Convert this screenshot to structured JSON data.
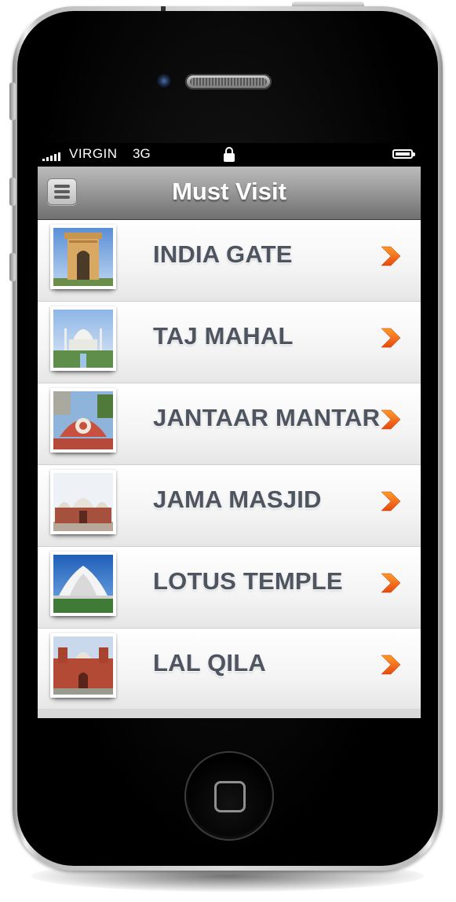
{
  "status_bar": {
    "carrier": "VIRGIN",
    "network": "3G"
  },
  "nav_bar": {
    "title": "Must Visit",
    "menu_icon": "hamburger-menu-icon"
  },
  "list": {
    "items": [
      {
        "label": "INDIA GATE",
        "thumbnail": "india-gate-thumbnail"
      },
      {
        "label": "TAJ MAHAL",
        "thumbnail": "taj-mahal-thumbnail"
      },
      {
        "label": "JANTAAR MANTAR",
        "thumbnail": "jantar-mantar-thumbnail"
      },
      {
        "label": "JAMA MASJID",
        "thumbnail": "jama-masjid-thumbnail"
      },
      {
        "label": "LOTUS TEMPLE",
        "thumbnail": "lotus-temple-thumbnail"
      },
      {
        "label": "LAL QILA",
        "thumbnail": "lal-qila-thumbnail"
      }
    ],
    "chevron_icon": "chevron-right-icon"
  },
  "colors": {
    "label_text": "#4e5560",
    "chevron_orange": "#f26a1b",
    "nav_gradient_top": "#bcbcbc",
    "nav_gradient_bottom": "#6f6f6f"
  }
}
